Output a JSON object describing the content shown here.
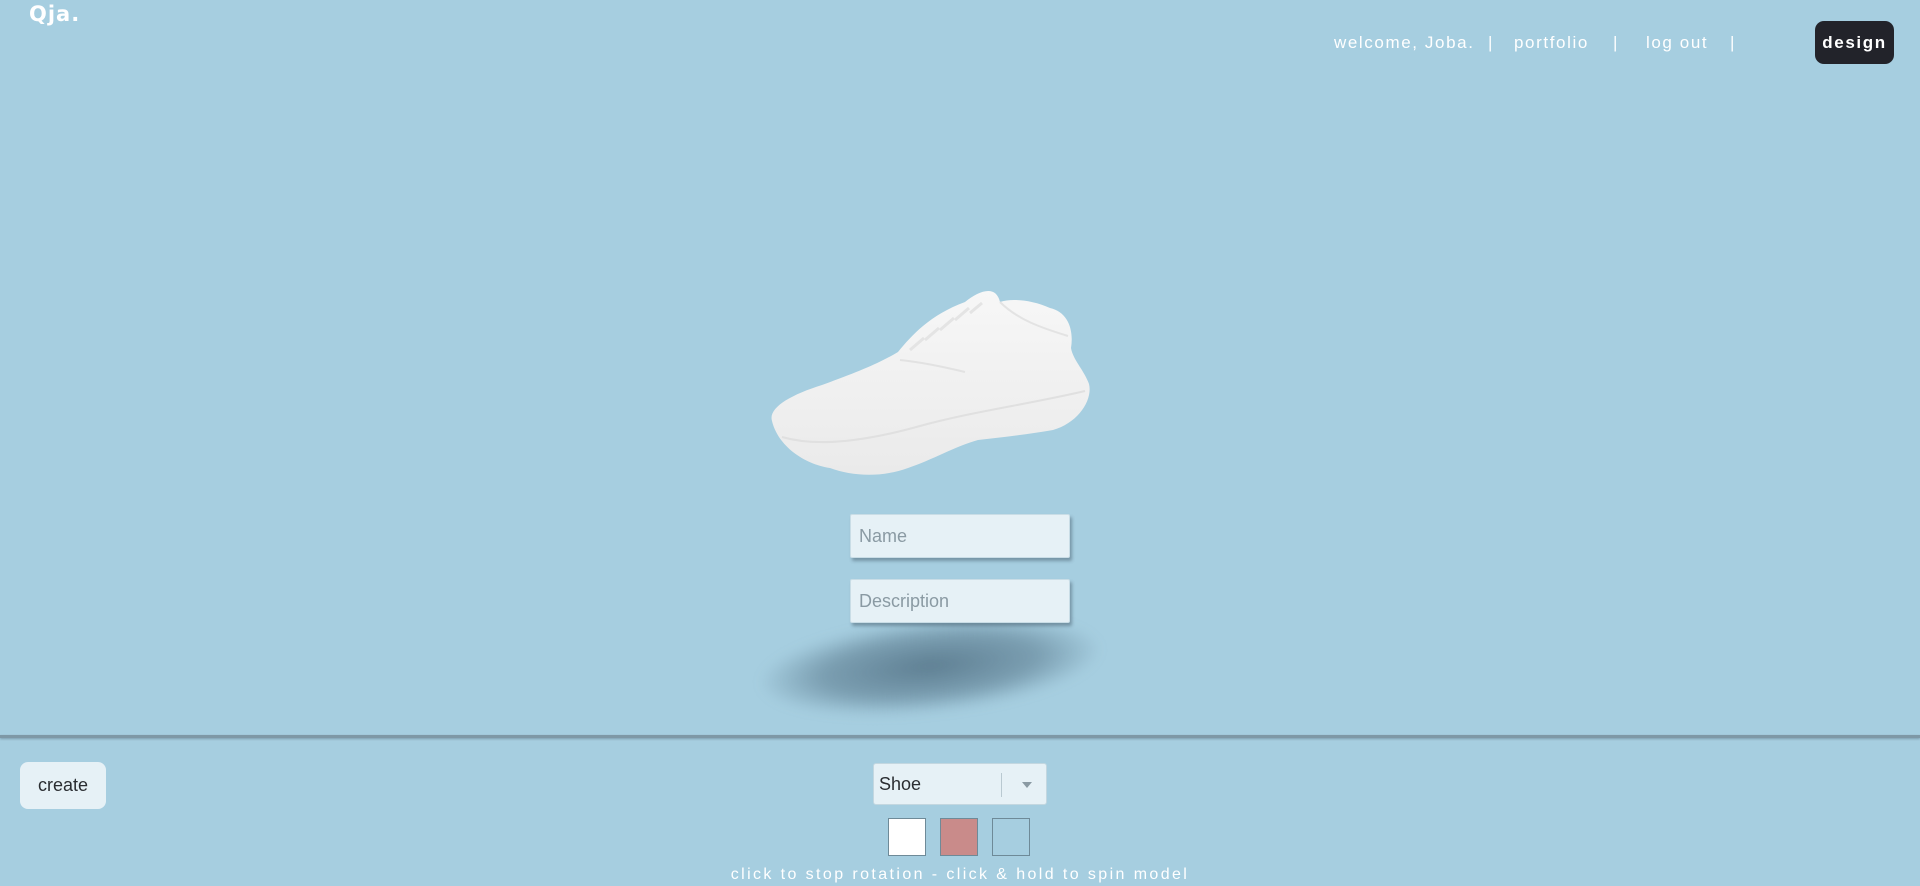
{
  "app": {
    "logo": "Qja."
  },
  "nav": {
    "welcome": "welcome, Joba.",
    "portfolio": "portfolio",
    "logout": "log out",
    "separator": "|",
    "design": "design"
  },
  "form": {
    "name_placeholder": "Name",
    "description_placeholder": "Description"
  },
  "toolbar": {
    "create_label": "create",
    "model_select": {
      "value": "Shoe"
    },
    "colors": [
      "#ffffff",
      "#c98b8a",
      "#a6cee0"
    ]
  },
  "hint": "click to stop rotation - click & hold to spin model",
  "theme": {
    "background": "#a6cee0",
    "accent_dark": "#22232a"
  }
}
